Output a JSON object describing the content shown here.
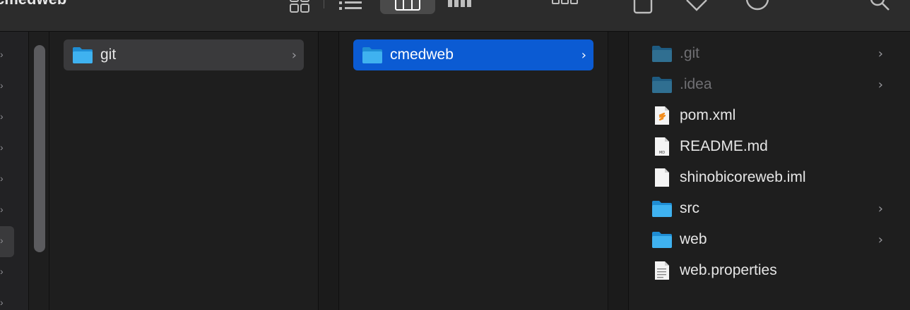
{
  "window": {
    "title": "cmedweb"
  },
  "toolbar": {
    "icons": [
      "icon-view-icon",
      "list-view-icon",
      "column-view-icon",
      "gallery-view-icon",
      "group-icon",
      "share-icon",
      "tag-icon",
      "action-icon",
      "search-icon"
    ]
  },
  "columns": [
    {
      "items": [
        {
          "label": "git",
          "type": "folder",
          "selected": "inactive",
          "has_children": true
        }
      ]
    },
    {
      "items": [
        {
          "label": "cmedweb",
          "type": "folder",
          "selected": "active",
          "has_children": true
        }
      ]
    },
    {
      "items": [
        {
          "label": ".git",
          "type": "folder",
          "hidden": true,
          "has_children": true
        },
        {
          "label": ".idea",
          "type": "folder",
          "hidden": true,
          "has_children": true
        },
        {
          "label": "pom.xml",
          "type": "xml-file",
          "has_children": false
        },
        {
          "label": "README.md",
          "type": "md-file",
          "badge": "MD",
          "has_children": false
        },
        {
          "label": "shinobicoreweb.iml",
          "type": "blank-file",
          "has_children": false
        },
        {
          "label": "src",
          "type": "folder",
          "has_children": true
        },
        {
          "label": "web",
          "type": "folder",
          "has_children": true
        },
        {
          "label": "web.properties",
          "type": "text-file",
          "has_children": false
        }
      ]
    }
  ],
  "colors": {
    "selection_blue": "#0b5bd3",
    "folder_blue": "#2fa6ea"
  }
}
